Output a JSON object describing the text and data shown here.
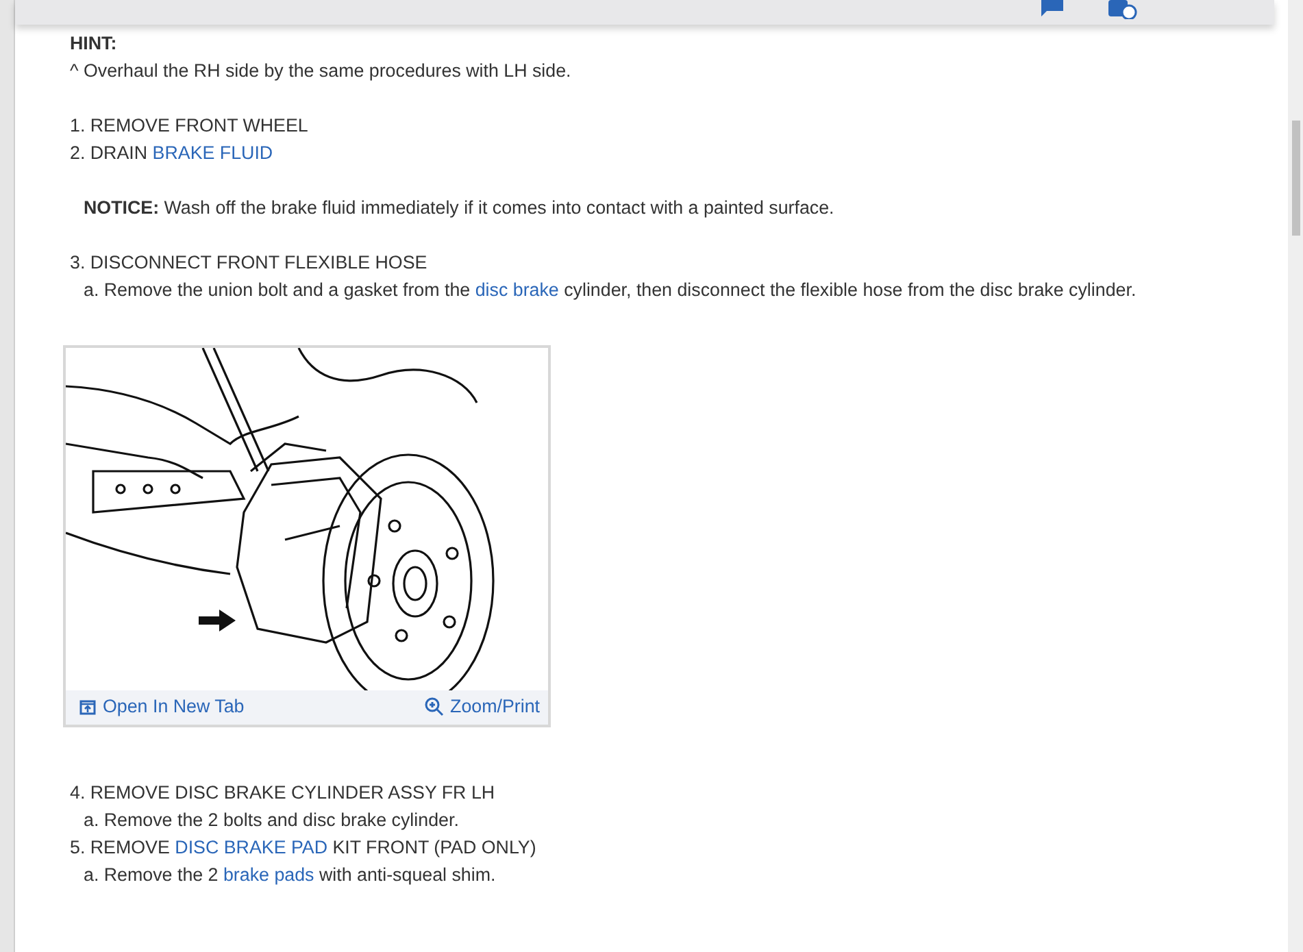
{
  "hint": {
    "title": "HINT:",
    "lines": [
      "^  Overhaul the RH side by the same procedures with LH side."
    ]
  },
  "steps_before": [
    {
      "indent": false,
      "parts": [
        {
          "kind": "text",
          "text": "1. REMOVE FRONT WHEEL"
        }
      ]
    },
    {
      "indent": false,
      "parts": [
        {
          "kind": "text",
          "text": "2. DRAIN "
        },
        {
          "kind": "link",
          "text": "BRAKE FLUID"
        }
      ]
    }
  ],
  "notice": {
    "label": "NOTICE:",
    "text": " Wash off the brake fluid immediately if it comes into contact with a painted surface."
  },
  "steps_middle": [
    {
      "indent": false,
      "parts": [
        {
          "kind": "text",
          "text": "3. DISCONNECT FRONT FLEXIBLE HOSE"
        }
      ]
    },
    {
      "indent": true,
      "parts": [
        {
          "kind": "text",
          "text": "a. Remove the union bolt and a gasket from the "
        },
        {
          "kind": "link",
          "text": "disc brake"
        },
        {
          "kind": "text",
          "text": " cylinder, then disconnect the flexible hose from the disc brake cylinder."
        }
      ]
    }
  ],
  "figure": {
    "open_link": "Open In New Tab",
    "zoom_link": "Zoom/Print"
  },
  "steps_after": [
    {
      "indent": false,
      "parts": [
        {
          "kind": "text",
          "text": "4. REMOVE DISC BRAKE CYLINDER ASSY FR LH"
        }
      ]
    },
    {
      "indent": true,
      "parts": [
        {
          "kind": "text",
          "text": "a. Remove the 2 bolts and disc brake cylinder."
        }
      ]
    },
    {
      "indent": false,
      "parts": [
        {
          "kind": "text",
          "text": "5. REMOVE "
        },
        {
          "kind": "link",
          "text": "DISC BRAKE PAD"
        },
        {
          "kind": "text",
          "text": " KIT FRONT (PAD ONLY)"
        }
      ]
    },
    {
      "indent": true,
      "parts": [
        {
          "kind": "text",
          "text": "a. Remove the 2 "
        },
        {
          "kind": "link",
          "text": "brake pads"
        },
        {
          "kind": "text",
          "text": " with anti-squeal shim."
        }
      ]
    }
  ]
}
